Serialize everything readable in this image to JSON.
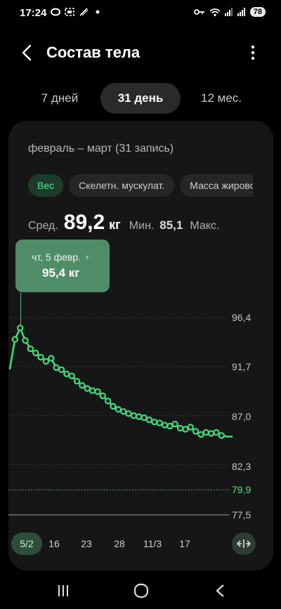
{
  "status_bar": {
    "time": "17:24",
    "battery": "78",
    "left_icons": [
      "o-ring-icon",
      "screenshot-icon",
      "stylus-icon",
      "dot-icon"
    ],
    "right_icons": [
      "key-icon",
      "wifi-icon",
      "signal-icon",
      "signal-icon"
    ]
  },
  "header": {
    "title": "Состав тела"
  },
  "tabs": [
    {
      "label": "7 дней",
      "active": false
    },
    {
      "label": "31 день",
      "active": true
    },
    {
      "label": "12 мес.",
      "active": false
    }
  ],
  "card": {
    "range_label": "февраль – март (31 запись)",
    "chips": [
      {
        "label": "Вес",
        "active": true
      },
      {
        "label": "Скелетн. мускулат.",
        "active": false
      },
      {
        "label": "Масса жирово",
        "active": false
      }
    ],
    "summary": {
      "avg_label": "Сред.",
      "avg_value": "89,2",
      "unit": "кг",
      "min_label": "Мин.",
      "min_value": "85,1",
      "max_label": "Макс."
    },
    "tooltip": {
      "date": "чт, 5 февр.",
      "chevron": "›",
      "value": "95,4 кг"
    },
    "x_axis": [
      "5/2",
      "16",
      "23",
      "28",
      "11/3",
      "17"
    ],
    "y_axis": [
      "96,4",
      "91,7",
      "87,0",
      "82,3",
      "79,9",
      "77,5"
    ]
  },
  "colors": {
    "accent": "#3fdc7c",
    "goal_line": "#5ee38f",
    "card_bg": "#161616",
    "tooltip_bg": "#4f8d68"
  },
  "chart_data": {
    "type": "line",
    "x": [
      1,
      2,
      3,
      4,
      5,
      6,
      7,
      8,
      9,
      10,
      11,
      12,
      13,
      14,
      15,
      16,
      17,
      18,
      19,
      20,
      21,
      22,
      23,
      24,
      25,
      26,
      27,
      28,
      29,
      30,
      31,
      32,
      33,
      34,
      35,
      36,
      37,
      38,
      39,
      40,
      41,
      42,
      43,
      44,
      45,
      46,
      47,
      48
    ],
    "y": [
      91.5,
      94.3,
      95.4,
      94.2,
      93.4,
      93.0,
      92.6,
      92.2,
      92.5,
      91.6,
      91.4,
      91.0,
      90.8,
      90.3,
      89.9,
      89.6,
      89.4,
      89.3,
      88.9,
      88.4,
      87.9,
      87.6,
      87.4,
      87.2,
      87.0,
      86.9,
      86.8,
      86.6,
      86.4,
      86.3,
      86.1,
      86.0,
      86.2,
      85.8,
      85.7,
      85.9,
      85.5,
      85.2,
      85.4,
      85.3,
      85.4,
      85.1,
      85.0,
      85.0
    ],
    "markers": [
      false,
      true,
      true,
      true,
      true,
      true,
      true,
      true,
      true,
      true,
      true,
      true,
      true,
      true,
      true,
      true,
      true,
      true,
      true,
      true,
      true,
      true,
      true,
      true,
      true,
      true,
      true,
      true,
      true,
      true,
      true,
      true,
      true,
      true,
      true,
      true,
      true,
      true,
      true,
      true,
      true,
      true,
      false,
      false
    ],
    "goal": 79.9,
    "ylim": [
      77.5,
      96.4
    ],
    "yticks": [
      96.4,
      91.7,
      87.0,
      82.3,
      77.5
    ]
  }
}
